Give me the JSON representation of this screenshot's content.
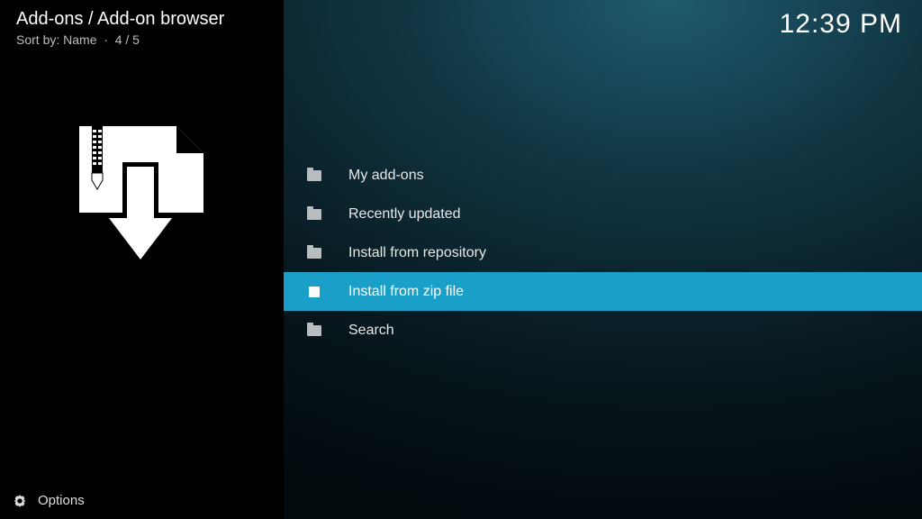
{
  "header": {
    "breadcrumb": "Add-ons / Add-on browser",
    "sort_label": "Sort by: Name",
    "position": "4 / 5",
    "clock": "12:39 PM"
  },
  "menu": {
    "items": [
      {
        "label": "My add-ons",
        "icon": "folder-icon",
        "selected": false
      },
      {
        "label": "Recently updated",
        "icon": "folder-icon",
        "selected": false
      },
      {
        "label": "Install from repository",
        "icon": "folder-icon",
        "selected": false
      },
      {
        "label": "Install from zip file",
        "icon": "zip-file-icon",
        "selected": true
      },
      {
        "label": "Search",
        "icon": "folder-icon",
        "selected": false
      }
    ]
  },
  "footer": {
    "options_label": "Options"
  }
}
